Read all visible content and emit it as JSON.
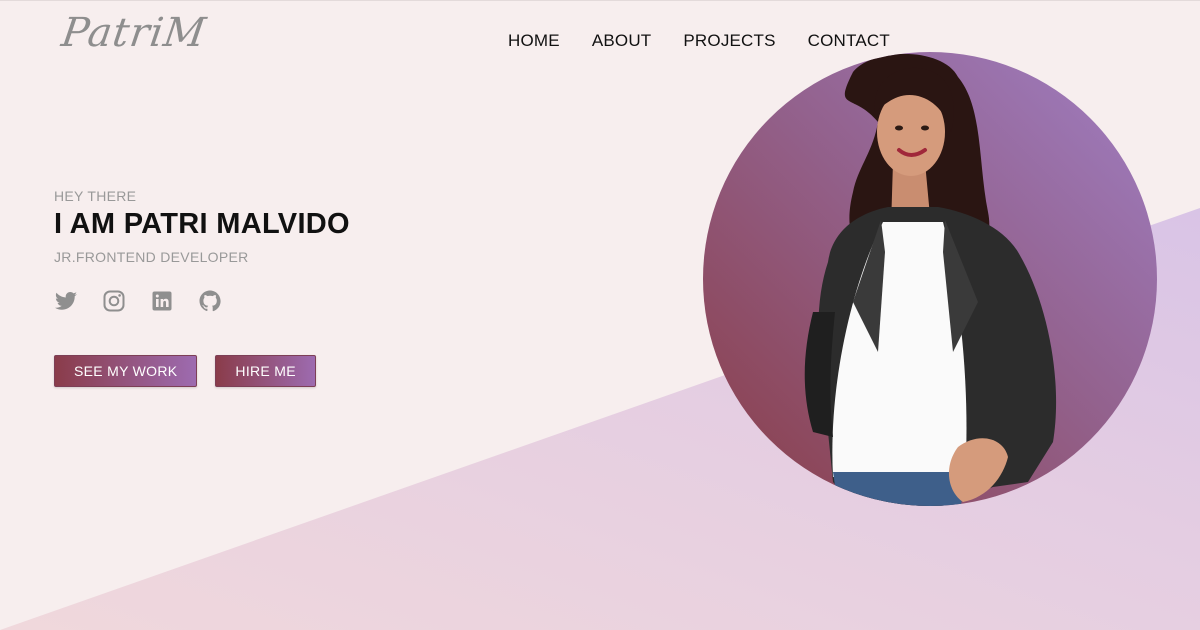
{
  "brand": {
    "logo_text": "PatriM"
  },
  "nav": {
    "items": [
      {
        "label": "HOME"
      },
      {
        "label": "ABOUT"
      },
      {
        "label": "PROJECTS"
      },
      {
        "label": "CONTACT"
      }
    ]
  },
  "hero": {
    "greeting": "HEY THERE",
    "name": "I AM PATRI MALVIDO",
    "role": "JR.FRONTEND DEVELOPER",
    "socials": [
      {
        "icon": "twitter-icon"
      },
      {
        "icon": "instagram-icon"
      },
      {
        "icon": "linkedin-icon"
      },
      {
        "icon": "github-icon"
      }
    ],
    "buttons": {
      "primary": "SEE MY WORK",
      "secondary": "HIRE ME"
    }
  },
  "colors": {
    "background": "#f7eeee",
    "accent_start": "#8a3c4a",
    "accent_end": "#9d6bb0",
    "muted_text": "#999999"
  }
}
